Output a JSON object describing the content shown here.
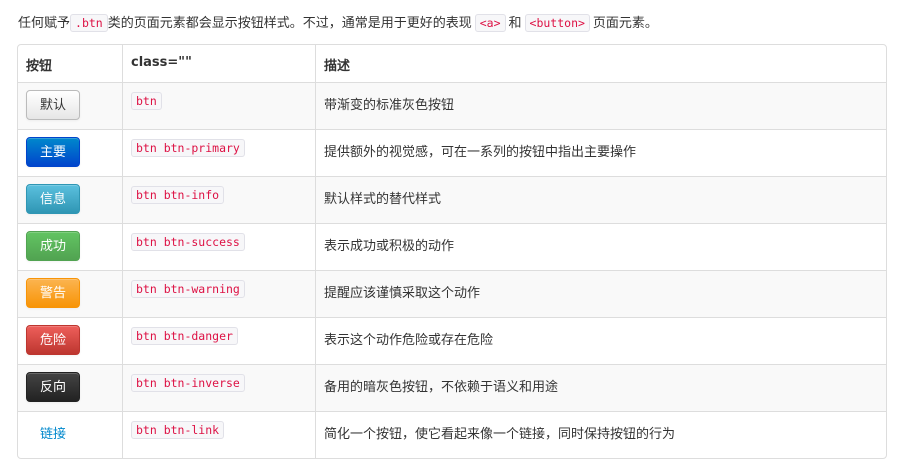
{
  "intro": {
    "before": "任何赋予",
    "code_btn": ".btn",
    "middle": "类的页面元素都会显示按钮样式。不过，通常是用于更好的表现",
    "code_a": "<a>",
    "and": "和",
    "code_button": "<button>",
    "after": "页面元素。"
  },
  "table": {
    "headers": [
      "按钮",
      "class=\"\"",
      "描述"
    ],
    "rows": [
      {
        "label": "默认",
        "cls": "btn",
        "desc": "带渐变的标准灰色按钮"
      },
      {
        "label": "主要",
        "cls": "btn btn-primary",
        "desc": "提供额外的视觉感，可在一系列的按钮中指出主要操作"
      },
      {
        "label": "信息",
        "cls": "btn btn-info",
        "desc": "默认样式的替代样式"
      },
      {
        "label": "成功",
        "cls": "btn btn-success",
        "desc": "表示成功或积极的动作"
      },
      {
        "label": "警告",
        "cls": "btn btn-warning",
        "desc": "提醒应该谨慎采取这个动作"
      },
      {
        "label": "危险",
        "cls": "btn btn-danger",
        "desc": "表示这个动作危险或存在危险"
      },
      {
        "label": "反向",
        "cls": "btn btn-inverse",
        "desc": "备用的暗灰色按钮，不依赖于语义和用途"
      },
      {
        "label": "链接",
        "cls": "btn btn-link",
        "desc": "简化一个按钮，使它看起来像一个链接，同时保持按钮的行为"
      }
    ]
  },
  "colors": {
    "primary": "#0044cc",
    "info": "#2f96b4",
    "success": "#51a351",
    "warning": "#f89406",
    "danger": "#bd362f",
    "inverse": "#222222",
    "link": "#0088cc",
    "code_text": "#d14"
  }
}
